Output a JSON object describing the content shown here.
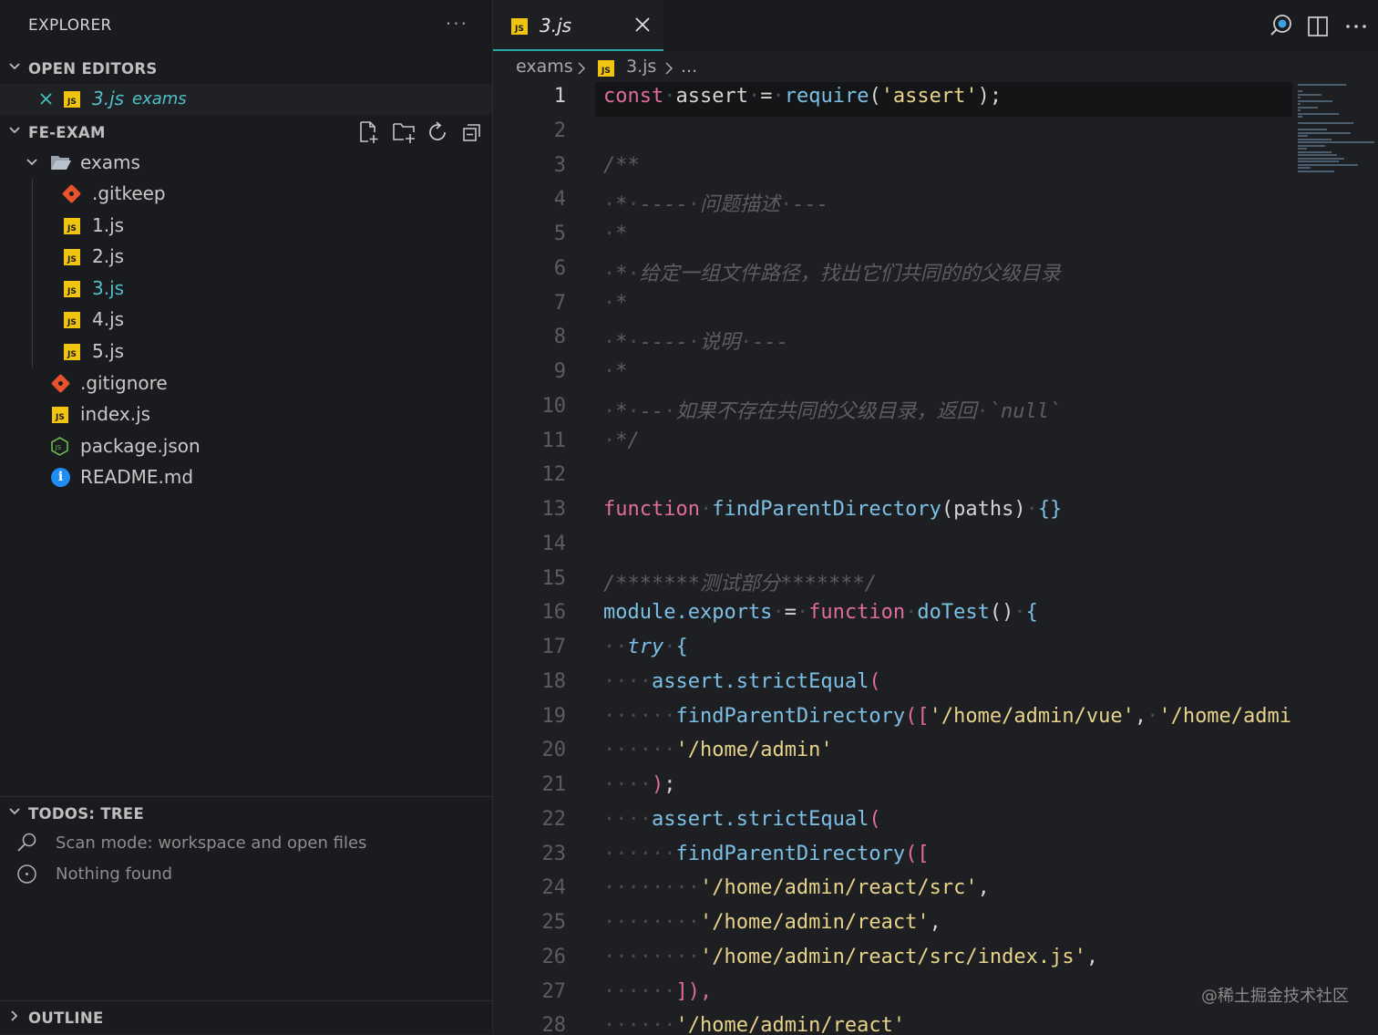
{
  "sidebar": {
    "title": "EXPLORER",
    "more": "···",
    "open_editors": {
      "label": "OPEN EDITORS",
      "items": [
        {
          "name": "3.js",
          "folder": "exams"
        }
      ]
    },
    "project": {
      "label": "FE-EXAM",
      "tree": [
        {
          "label": "exams"
        },
        {
          "label": ".gitkeep"
        },
        {
          "label": "1.js"
        },
        {
          "label": "2.js"
        },
        {
          "label": "3.js"
        },
        {
          "label": "4.js"
        },
        {
          "label": "5.js"
        },
        {
          "label": ".gitignore"
        },
        {
          "label": "index.js"
        },
        {
          "label": "package.json"
        },
        {
          "label": "README.md"
        }
      ]
    },
    "todos": {
      "label": "TODOS: TREE",
      "scan_mode": "Scan mode: workspace and open files",
      "result": "Nothing found"
    },
    "outline": {
      "label": "OUTLINE"
    }
  },
  "editor": {
    "tab": {
      "label": "3.js"
    },
    "breadcrumb": {
      "folder": "exams",
      "file": "3.js",
      "more": "..."
    },
    "current_line": 1,
    "lines": [
      [
        [
          "kw",
          "const"
        ],
        [
          "ws",
          "·"
        ],
        [
          "vr",
          "assert"
        ],
        [
          "ws",
          "·"
        ],
        [
          "pn",
          "="
        ],
        [
          "ws",
          "·"
        ],
        [
          "fn",
          "require"
        ],
        [
          "pn",
          "("
        ],
        [
          "str",
          "'assert'"
        ],
        [
          "pn",
          ");"
        ]
      ],
      [],
      [
        [
          "cm",
          "/**"
        ]
      ],
      [
        [
          "ws",
          "·"
        ],
        [
          "cm",
          "*"
        ],
        [
          "ws",
          "·"
        ],
        [
          "cm",
          "----"
        ],
        [
          "ws",
          "·"
        ],
        [
          "cm",
          "问题描述"
        ],
        [
          "ws",
          "·"
        ],
        [
          "cm",
          "---"
        ]
      ],
      [
        [
          "ws",
          "·"
        ],
        [
          "cm",
          "*"
        ]
      ],
      [
        [
          "ws",
          "·"
        ],
        [
          "cm",
          "*"
        ],
        [
          "ws",
          "·"
        ],
        [
          "cm",
          "给定一组文件路径，找出它们共同的的父级目录"
        ]
      ],
      [
        [
          "ws",
          "·"
        ],
        [
          "cm",
          "*"
        ]
      ],
      [
        [
          "ws",
          "·"
        ],
        [
          "cm",
          "*"
        ],
        [
          "ws",
          "·"
        ],
        [
          "cm",
          "----"
        ],
        [
          "ws",
          "·"
        ],
        [
          "cm",
          "说明"
        ],
        [
          "ws",
          "·"
        ],
        [
          "cm",
          "---"
        ]
      ],
      [
        [
          "ws",
          "·"
        ],
        [
          "cm",
          "*"
        ]
      ],
      [
        [
          "ws",
          "·"
        ],
        [
          "cm",
          "*"
        ],
        [
          "ws",
          "·"
        ],
        [
          "cm",
          "--"
        ],
        [
          "ws",
          "·"
        ],
        [
          "cm",
          "如果不存在共同的父级目录，返回"
        ],
        [
          "ws",
          "·"
        ],
        [
          "cm",
          "`null`"
        ]
      ],
      [
        [
          "ws",
          "·"
        ],
        [
          "cm",
          "*/"
        ]
      ],
      [],
      [
        [
          "kw",
          "function"
        ],
        [
          "ws",
          "·"
        ],
        [
          "fn",
          "findParentDirectory"
        ],
        [
          "pn",
          "(paths)"
        ],
        [
          "ws",
          "·"
        ],
        [
          "bb",
          "{}"
        ]
      ],
      [],
      [
        [
          "cm",
          "/*******测试部分*******/"
        ]
      ],
      [
        [
          "fn",
          "module.exports"
        ],
        [
          "ws",
          "·"
        ],
        [
          "pn",
          "="
        ],
        [
          "ws",
          "·"
        ],
        [
          "kw",
          "function"
        ],
        [
          "ws",
          "·"
        ],
        [
          "fn",
          "doTest"
        ],
        [
          "pn",
          "()"
        ],
        [
          "ws",
          "·"
        ],
        [
          "bb",
          "{"
        ]
      ],
      [
        [
          "ws",
          "··"
        ],
        [
          "kt",
          "try"
        ],
        [
          "ws",
          "·"
        ],
        [
          "bb",
          "{"
        ]
      ],
      [
        [
          "ws",
          "····"
        ],
        [
          "fn",
          "assert.strictEqual"
        ],
        [
          "br",
          "("
        ]
      ],
      [
        [
          "ws",
          "······"
        ],
        [
          "fn",
          "findParentDirectory"
        ],
        [
          "br",
          "(["
        ],
        [
          "str",
          "'/home/admin/vue'"
        ],
        [
          "pn",
          ","
        ],
        [
          "ws",
          "·"
        ],
        [
          "str",
          "'/home/admin/react'"
        ],
        [
          "br",
          "]),"
        ]
      ],
      [
        [
          "ws",
          "······"
        ],
        [
          "str",
          "'/home/admin'"
        ]
      ],
      [
        [
          "ws",
          "····"
        ],
        [
          "br",
          ")"
        ],
        [
          "pn",
          ";"
        ]
      ],
      [
        [
          "ws",
          "····"
        ],
        [
          "fn",
          "assert.strictEqual"
        ],
        [
          "br",
          "("
        ]
      ],
      [
        [
          "ws",
          "······"
        ],
        [
          "fn",
          "findParentDirectory"
        ],
        [
          "br",
          "(["
        ]
      ],
      [
        [
          "ws",
          "········"
        ],
        [
          "str",
          "'/home/admin/react/src'"
        ],
        [
          "pn",
          ","
        ]
      ],
      [
        [
          "ws",
          "········"
        ],
        [
          "str",
          "'/home/admin/react'"
        ],
        [
          "pn",
          ","
        ]
      ],
      [
        [
          "ws",
          "········"
        ],
        [
          "str",
          "'/home/admin/react/src/index.js'"
        ],
        [
          "pn",
          ","
        ]
      ],
      [
        [
          "ws",
          "······"
        ],
        [
          "br",
          "]),"
        ]
      ],
      [
        [
          "ws",
          "······"
        ],
        [
          "str",
          "'/home/admin/react'"
        ]
      ]
    ]
  },
  "watermark": "@稀土掘金技术社区",
  "colors": {
    "accent": "#2aa9a6",
    "js_icon": "#f1c40f",
    "git_icon": "#e8532b",
    "info_icon": "#1e8ef2"
  }
}
